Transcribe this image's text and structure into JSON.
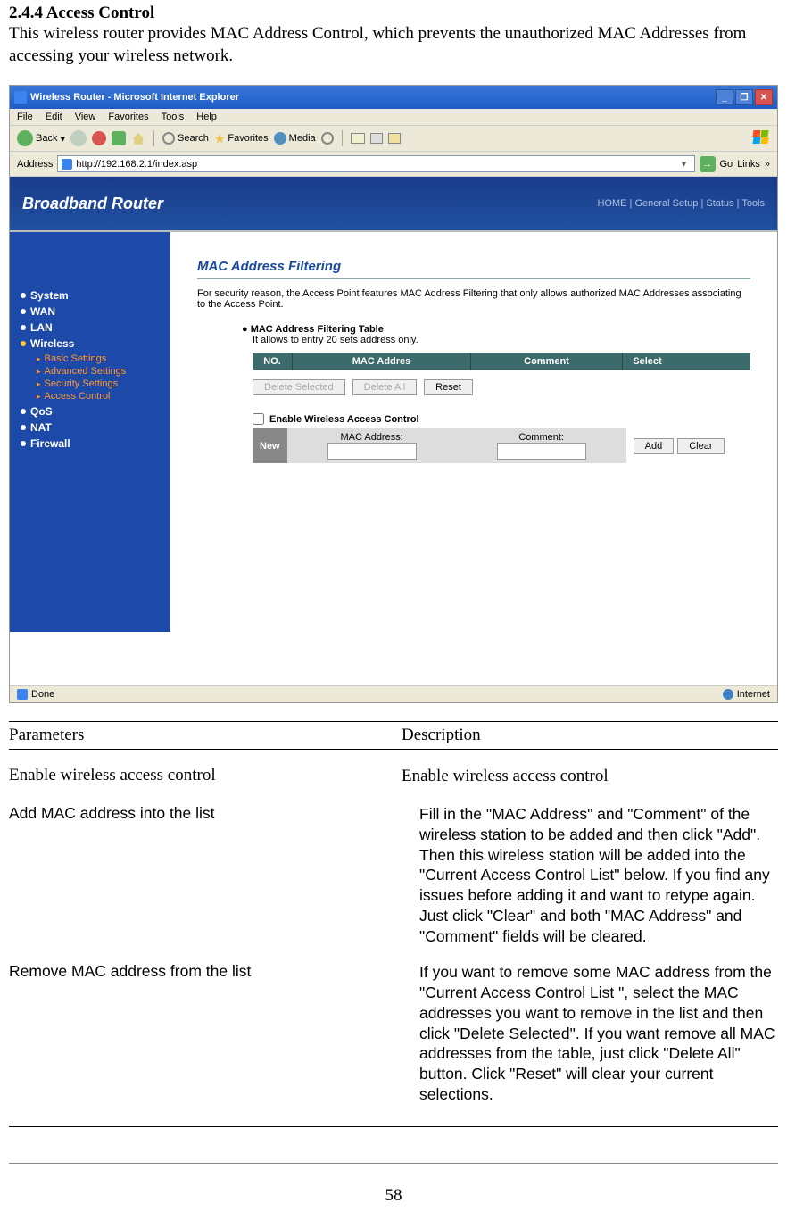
{
  "doc": {
    "heading": "2.4.4 Access Control",
    "intro": "This wireless router provides MAC Address Control, which prevents the unauthorized MAC Addresses from accessing your wireless network.",
    "page_number": "58"
  },
  "browser": {
    "title": "Wireless Router - Microsoft Internet Explorer",
    "menus": {
      "file": "File",
      "edit": "Edit",
      "view": "View",
      "favorites": "Favorites",
      "tools": "Tools",
      "help": "Help"
    },
    "toolbar": {
      "back": "Back",
      "search": "Search",
      "favorites": "Favorites",
      "media": "Media"
    },
    "address_label": "Address",
    "address_value": "http://192.168.2.1/index.asp",
    "go": "Go",
    "links": "Links",
    "status_done": "Done",
    "status_zone": "Internet"
  },
  "router": {
    "brand": "Broadband Router",
    "nav": "HOME | General Setup | Status | Tools",
    "sidebar": {
      "system": "System",
      "wan": "WAN",
      "lan": "LAN",
      "wireless": "Wireless",
      "basic": "Basic Settings",
      "advanced": "Advanced Settings",
      "security": "Security Settings",
      "access": "Access Control",
      "qos": "QoS",
      "nat": "NAT",
      "firewall": "Firewall"
    },
    "content": {
      "title": "MAC Address Filtering",
      "desc": "For security reason, the Access Point features MAC Address Filtering that only allows authorized MAC Addresses associating to the Access Point.",
      "table_title": "MAC Address Filtering Table",
      "table_note": "It allows to entry 20 sets address only.",
      "th_no": "NO.",
      "th_mac": "MAC Addres",
      "th_comment": "Comment",
      "th_select": "Select",
      "btn_delete_selected": "Delete Selected",
      "btn_delete_all": "Delete All",
      "btn_reset": "Reset",
      "enable_label": "Enable Wireless Access Control",
      "new_label": "New",
      "mac_address_label": "MAC Address:",
      "comment_label": "Comment:",
      "btn_add": "Add",
      "btn_clear": "Clear"
    }
  },
  "params": {
    "header_col1": "Parameters",
    "header_col2": "Description",
    "row1": {
      "name": "Enable wireless access control",
      "desc": "Enable wireless access control"
    },
    "row2": {
      "name": "Add MAC address into the list",
      "desc": "Fill in the \"MAC Address\" and \"Comment\" of the wireless station to be added and then click \"Add\". Then this wireless station will be added into the \"Current Access Control List\" below. If you find any issues before adding it and want to retype again. Just click \"Clear\" and both \"MAC Address\" and \"Comment\" fields will be cleared."
    },
    "row3": {
      "name": "Remove MAC address from the list",
      "desc": "If you want to remove some MAC address from the \"Current Access Control List \", select the MAC addresses you want to remove in the list and then click \"Delete Selected\". If you want remove all MAC addresses from the table, just click \"Delete All\" button. Click \"Reset\" will clear your current selections."
    }
  }
}
